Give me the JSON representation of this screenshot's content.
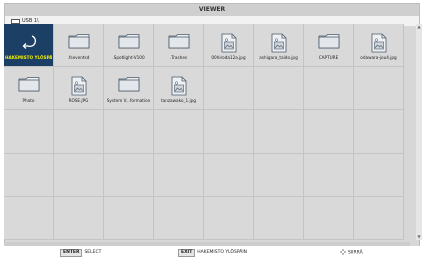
{
  "window": {
    "title": "VIEWER"
  },
  "path": {
    "text": "USB 1\\"
  },
  "items": [
    {
      "label": "HAKEMISTO YLÖSPÄIN",
      "icon": "folder-up-icon",
      "type": "up",
      "selected": true
    },
    {
      "label": ".fseventsd",
      "icon": "folder-icon",
      "type": "folder"
    },
    {
      "label": ".Spotlight-V100",
      "icon": "folder-icon",
      "type": "folder"
    },
    {
      "label": ".Trashes",
      "icon": "folder-icon",
      "type": "folder"
    },
    {
      "label": "00hiroda12a.jpg",
      "icon": "image-file-icon",
      "type": "image"
    },
    {
      "label": "ashigara_taido.jpg",
      "icon": "image-file-icon",
      "type": "image"
    },
    {
      "label": "CAPTURE",
      "icon": "folder-icon",
      "type": "folder"
    },
    {
      "label": "odawara-jou4.jpg",
      "icon": "image-file-icon",
      "type": "image"
    },
    {
      "label": "Photo",
      "icon": "folder-icon",
      "type": "folder"
    },
    {
      "label": "ROSE.JPG",
      "icon": "image-file-icon",
      "type": "image"
    },
    {
      "label": "System V...formation",
      "icon": "folder-icon",
      "type": "folder"
    },
    {
      "label": "tanzawako_1.jpg",
      "icon": "image-file-icon",
      "type": "image"
    }
  ],
  "footer": {
    "enter_key": "ENTER",
    "enter_label": "SELECT",
    "exit_key": "EXIT",
    "exit_label": "HAKEMISTO YLÖSPÄIN",
    "nav_label": "SIIRRÄ"
  },
  "colors": {
    "selected_bg": "#1c3f66",
    "selected_text": "#f1ec00",
    "cell_bg": "#d9d9d9"
  }
}
